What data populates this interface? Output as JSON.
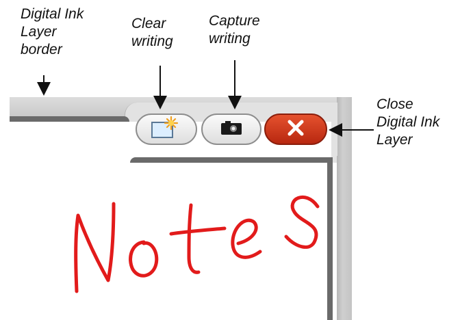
{
  "callouts": {
    "ink_border": [
      "Digital Ink",
      "Layer",
      "border"
    ],
    "clear": [
      "Clear",
      "writing"
    ],
    "capture": [
      "Capture",
      "writing"
    ],
    "close": [
      "Close",
      "Digital Ink",
      "Layer"
    ]
  },
  "toolbar": {
    "clear_icon": "eraser-sun-icon",
    "capture_icon": "camera-icon",
    "close_icon": "close-x-icon",
    "close_color": "#d0401e"
  },
  "canvas": {
    "handwriting": "Notes",
    "ink_color": "#e21b1b"
  }
}
